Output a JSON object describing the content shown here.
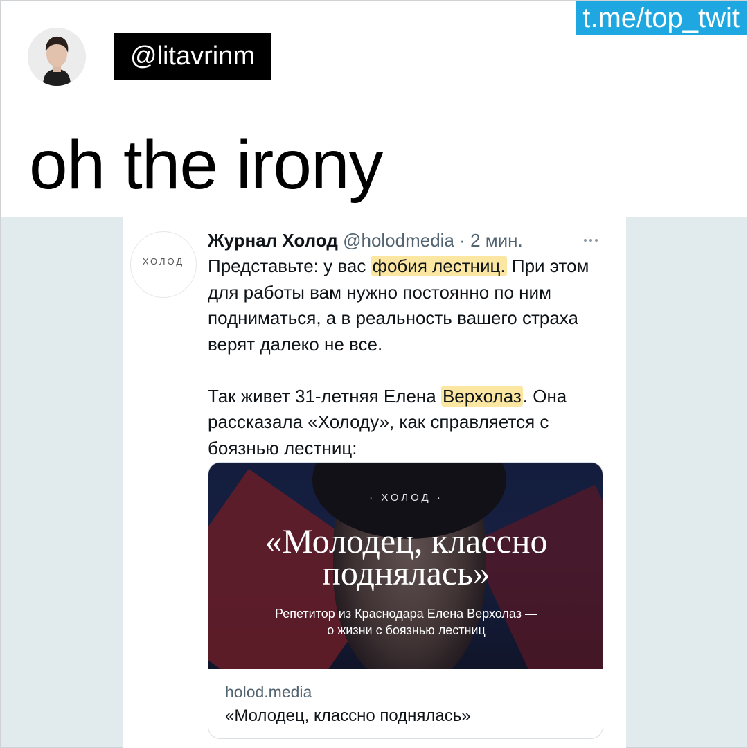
{
  "channel": {
    "label": "t.me/top_twit"
  },
  "author": {
    "handle": "@litavrinm"
  },
  "post": {
    "text": "oh the irony"
  },
  "embedded_tweet": {
    "avatar_label": "-ХОЛОД-",
    "name": "Журнал Холод",
    "handle": "@holodmedia",
    "separator": "·",
    "time": "2 мин.",
    "body": {
      "p1_start": "Представьте: у вас ",
      "p1_highlight": "фобия лестниц.",
      "p1_end": " При этом для работы вам нужно постоянно по ним подниматься, а в реальность вашего страха верят далеко не все.",
      "p2_start": "Так живет 31-летняя Елена ",
      "p2_highlight": "Верхолаз",
      "p2_end": ". Она рассказала «Холоду», как справляется с боязнью лестниц:"
    },
    "link_card": {
      "kicker": "· ХОЛОД ·",
      "headline": "«Молодец, классно поднялась»",
      "subtitle_line1": "Репетитор из Краснодара Елена Верхолаз —",
      "subtitle_line2": "о жизни с боязнью лестниц",
      "domain": "holod.media",
      "title": "«Молодец, классно поднялась»"
    }
  },
  "colors": {
    "channel_badge": "#1ea7e0",
    "highlight": "#fbe7a1",
    "screenshot_background": "#e1ebee"
  },
  "icons": {
    "more": "more-horizontal-icon"
  }
}
